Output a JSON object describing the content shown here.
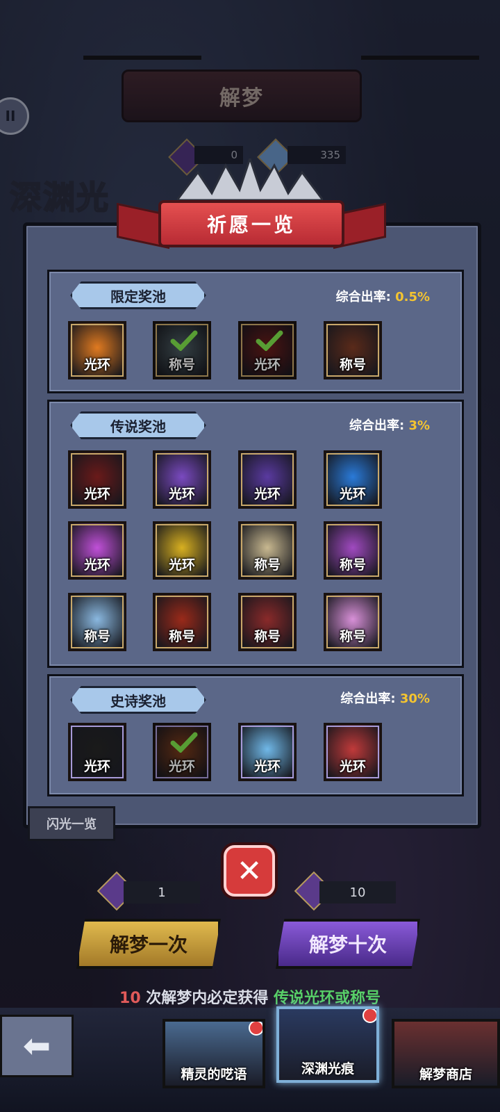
{
  "header": {
    "title": "解梦",
    "bg_title": "深渊光",
    "pause_glyph": "II"
  },
  "currency": {
    "gem_count": "0",
    "diamond_count": "335"
  },
  "modal": {
    "title": "祈愿一览",
    "pools": [
      {
        "label": "限定奖池",
        "rate_label": "综合出率:",
        "rate_value": "0.5%",
        "items": [
          {
            "tag": "光环",
            "owned": false,
            "color": "#e07a20"
          },
          {
            "tag": "称号",
            "owned": true,
            "color": "#4a5a60"
          },
          {
            "tag": "光环",
            "owned": true,
            "color": "#6a1a1a"
          },
          {
            "tag": "称号",
            "owned": false,
            "color": "#5a2a1a"
          }
        ]
      },
      {
        "label": "传说奖池",
        "rate_label": "综合出率:",
        "rate_value": "3%",
        "items": [
          {
            "tag": "光环",
            "owned": false,
            "color": "#6a1a1a"
          },
          {
            "tag": "光环",
            "owned": false,
            "color": "#7a4ac0"
          },
          {
            "tag": "光环",
            "owned": false,
            "color": "#5a3aa0"
          },
          {
            "tag": "光环",
            "owned": false,
            "color": "#2a7ad8"
          },
          {
            "tag": "光环",
            "owned": false,
            "color": "#c050d8"
          },
          {
            "tag": "光环",
            "owned": false,
            "color": "#d8b020"
          },
          {
            "tag": "称号",
            "owned": false,
            "color": "#c8b890"
          },
          {
            "tag": "称号",
            "owned": false,
            "color": "#a04ac0"
          },
          {
            "tag": "称号",
            "owned": false,
            "color": "#8ab8e0"
          },
          {
            "tag": "称号",
            "owned": false,
            "color": "#9a2a1a"
          },
          {
            "tag": "称号",
            "owned": false,
            "color": "#8a2a2a"
          },
          {
            "tag": "称号",
            "owned": false,
            "color": "#d890d8"
          }
        ]
      },
      {
        "label": "史诗奖池",
        "rate_label": "综合出率:",
        "rate_value": "30%",
        "items": [
          {
            "tag": "光环",
            "owned": false,
            "color": "#1a1a1a"
          },
          {
            "tag": "光环",
            "owned": true,
            "color": "#7a3a1a"
          },
          {
            "tag": "光环",
            "owned": false,
            "color": "#70b8e8"
          },
          {
            "tag": "光环",
            "owned": false,
            "color": "#c03a3a"
          }
        ]
      }
    ]
  },
  "flash_button": "闪光一览",
  "close_glyph": "✕",
  "draw": {
    "once_cost": "1",
    "once_label": "解梦一次",
    "ten_cost": "10",
    "ten_label": "解梦十次"
  },
  "guarantee": {
    "count": "10",
    "text": " 次解梦内必定获得 ",
    "highlight": "传说光环或称号"
  },
  "tabs": [
    {
      "label": "精灵的呓语",
      "color": "#4a6a90"
    },
    {
      "label": "深渊光痕",
      "color": "#2a3a60"
    },
    {
      "label": "解梦商店",
      "color": "#6a3030"
    }
  ],
  "back_glyph": "⬅"
}
